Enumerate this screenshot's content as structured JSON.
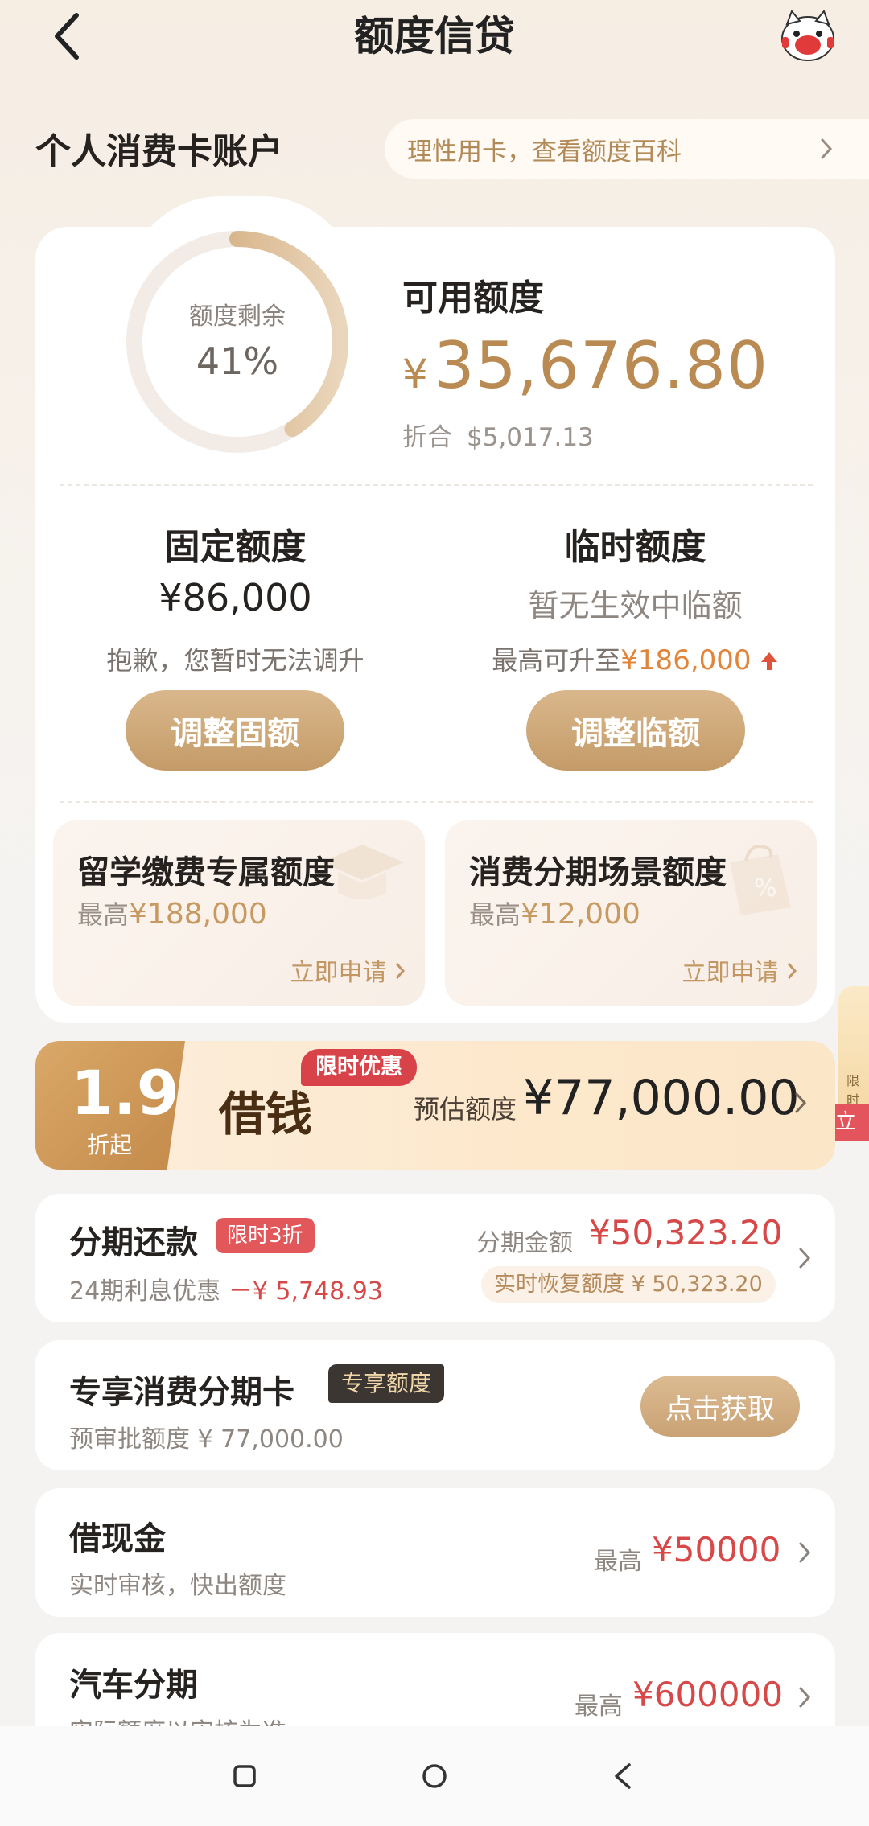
{
  "header": {
    "title": "额度信贷"
  },
  "account": {
    "title": "个人消费卡账户",
    "tip": "理性用卡，查看额度百科"
  },
  "credit": {
    "ring_label": "额度剩余",
    "ring_value": "41%",
    "ring_fraction": 0.41,
    "available_label": "可用额度",
    "available_currency": "¥",
    "available_amount": "35,676.80",
    "equiv_prefix": "折合",
    "equiv_amount": "$5,017.13"
  },
  "fixed": {
    "title": "固定额度",
    "amount": "¥86,000",
    "note": "抱歉，您暂时无法调升",
    "button": "调整固额"
  },
  "temporary": {
    "title": "临时额度",
    "status": "暂无生效中临额",
    "note_prefix": "最高可升至",
    "note_amount": "¥186,000",
    "button": "调整临额"
  },
  "special_limits": [
    {
      "title": "留学缴费专属额度",
      "max_prefix": "最高",
      "max_amount": "¥188,000",
      "link": "立即申请"
    },
    {
      "title": "消费分期场景额度",
      "max_prefix": "最高",
      "max_amount": "¥12,000",
      "link": "立即申请"
    }
  ],
  "side_tabs": {
    "top": "限时",
    "bottom": "立"
  },
  "loan_banner": {
    "discount": "1.9",
    "discount_unit": "折起",
    "title": "借钱",
    "badge": "限时优惠",
    "est_label": "预估额度",
    "est_amount": "¥77,000.00"
  },
  "installment": {
    "title": "分期还款",
    "tag": "限时3折",
    "sub_prefix": "24期利息优惠",
    "sub_amount": "－¥ 5,748.93",
    "amount_label": "分期金额",
    "amount": "¥50,323.20",
    "recover": "实时恢复额度 ¥ 50,323.20"
  },
  "exclusive_card": {
    "title": "专享消费分期卡",
    "tag": "专享额度",
    "sub": "预审批额度 ¥ 77,000.00",
    "button": "点击获取"
  },
  "cash_loan": {
    "title": "借现金",
    "sub": "实时审核，快出额度",
    "max_label": "最高",
    "max_amount": "¥50000"
  },
  "car_loan": {
    "title": "汽车分期",
    "sub": "实际额度以审核为准",
    "max_label": "最高",
    "max_amount": "¥600000"
  },
  "colors": {
    "accent_gold": "#b98a52",
    "button_gold": "#c49b68",
    "alert_red": "#d74848",
    "highlight_orange": "#e0853a"
  },
  "icons": {
    "back": "chevron-left-icon",
    "mascot": "mascot-icon",
    "nav_recent": "square-icon",
    "nav_home": "circle-icon",
    "nav_back": "triangle-back-icon"
  }
}
